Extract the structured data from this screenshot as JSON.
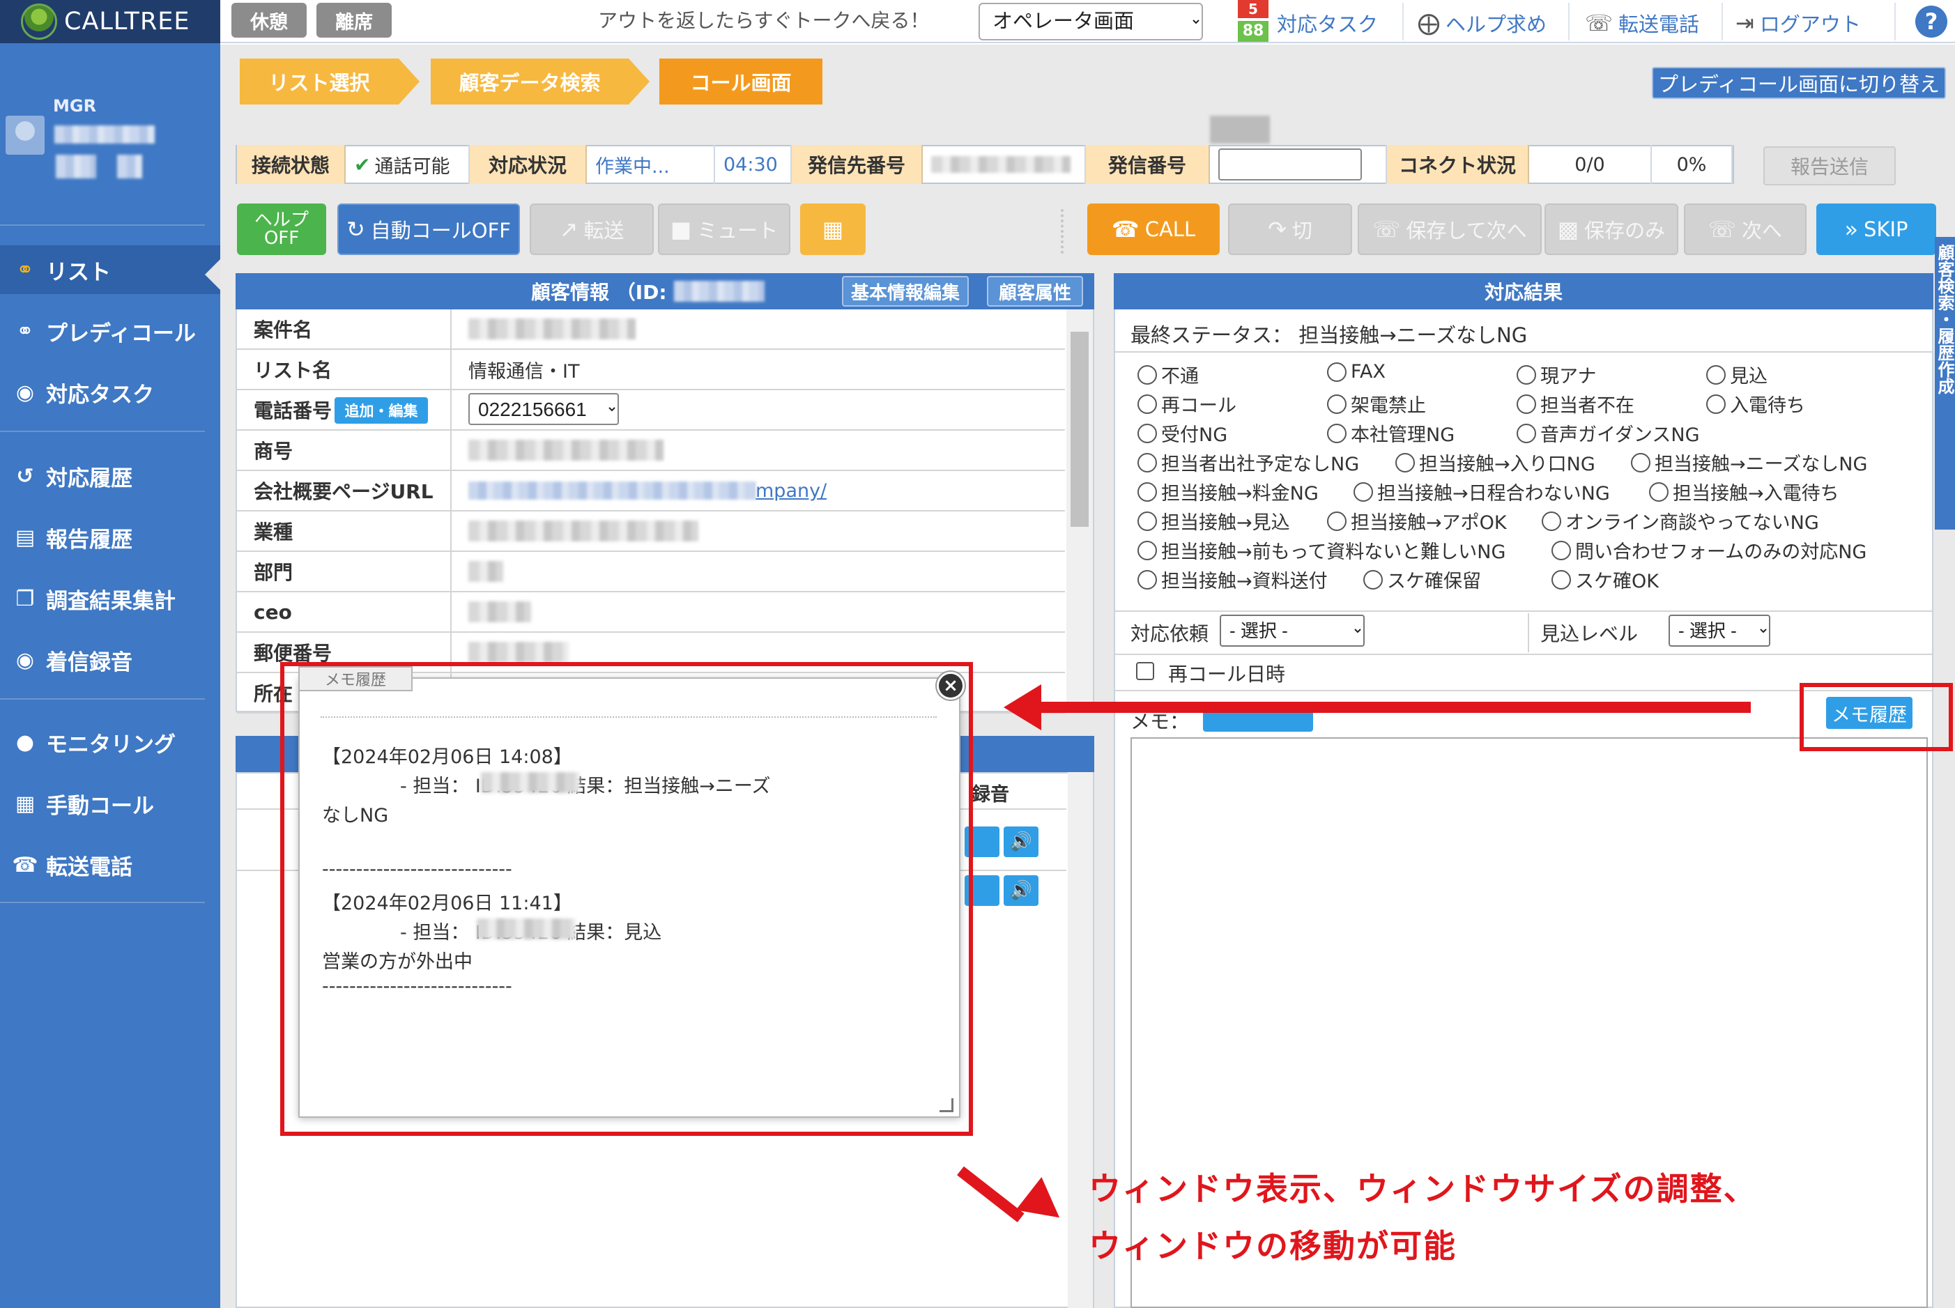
{
  "app": {
    "logo": "CALLTREE"
  },
  "sidebar": {
    "role": "MGR",
    "items": [
      {
        "label": "リスト",
        "icon": "headset-icon"
      },
      {
        "label": "プレディコール",
        "icon": "headset-icon"
      },
      {
        "label": "対応タスク",
        "icon": "task-icon"
      },
      {
        "label": "対応履歴",
        "icon": "history-icon"
      },
      {
        "label": "報告履歴",
        "icon": "calendar-icon"
      },
      {
        "label": "調査結果集計",
        "icon": "copy-icon"
      },
      {
        "label": "着信録音",
        "icon": "record-icon"
      },
      {
        "label": "モニタリング",
        "icon": "monitor-icon"
      },
      {
        "label": "手動コール",
        "icon": "keypad-icon"
      },
      {
        "label": "転送電話",
        "icon": "transfer-icon"
      }
    ]
  },
  "topbar": {
    "break_label": "休憩",
    "away_label": "離席",
    "message": "アウトを返したらすぐトークへ戻る！",
    "view_selected": "オペレータ画面",
    "badge_top": "5",
    "badge_bottom": "88",
    "task_label": "対応タスク",
    "help_label": "ヘルプ求め",
    "transfer_label": "転送電話",
    "logout_label": "ログアウト",
    "question": "?"
  },
  "steps": [
    "リスト選択",
    "顧客データ検索",
    "コール画面"
  ],
  "switch_label": "プレディコール画面に切り替え",
  "status_strip": {
    "conn_label": "接続状態",
    "conn_value": "通話可能",
    "resp_label": "対応状況",
    "resp_value": "作業中...",
    "timer": "04:30",
    "dest_label": "発信先番号",
    "caller_label": "発信番号",
    "connect_label": "コネクト状況",
    "connect_count": "0/0",
    "connect_pct": "0%",
    "report_label": "報告送信"
  },
  "actions": {
    "help_line1": "ヘルプ",
    "help_line2": "OFF",
    "auto_call": "自動コールOFF",
    "transfer": "転送",
    "mute": "ミュート",
    "call": "CALL",
    "hangup": "切",
    "save_next": "保存して次へ",
    "save_only": "保存のみ",
    "next": "次へ",
    "skip": "SKIP"
  },
  "customer": {
    "header": "顧客情報 （ID:",
    "edit_basic": "基本情報編集",
    "attributes": "顧客属性",
    "rows": [
      {
        "label": "案件名",
        "value": ""
      },
      {
        "label": "リスト名",
        "value": "情報通信・IT"
      },
      {
        "label": "電話番号",
        "value": ""
      },
      {
        "label": "商号",
        "value": ""
      },
      {
        "label": "会社概要ページURL",
        "value": "mpany/"
      },
      {
        "label": "業種",
        "value": ""
      },
      {
        "label": "部門",
        "value": ""
      },
      {
        "label": "ceo",
        "value": ""
      },
      {
        "label": "郵便番号",
        "value": ""
      },
      {
        "label": "所在",
        "value": ""
      }
    ],
    "add_edit": "追加・編集",
    "phone": "0222156661"
  },
  "history": {
    "rec_label": "録音"
  },
  "result": {
    "header": "対応結果",
    "final_status": "最終ステータス：  担当接触→ニーズなしNG",
    "options": [
      "不通",
      "FAX",
      "現アナ",
      "見込",
      "再コール",
      "架電禁止",
      "担当者不在",
      "入電待ち",
      "受付NG",
      "本社管理NG",
      "音声ガイダンスNG",
      "担当者出社予定なしNG",
      "担当接触→入り口NG",
      "担当接触→ニーズなしNG",
      "担当接触→料金NG",
      "担当接触→日程合わないNG",
      "担当接触→入電待ち",
      "担当接触→見込",
      "担当接触→アポOK",
      "オンライン商談やってないNG",
      "担当接触→前もって資料ないと難しいNG",
      "問い合わせフォームのみの対応NG",
      "担当接触→資料送付",
      "スケ確保留",
      "スケ確OK"
    ],
    "request_label": "対応依頼",
    "request_value": "- 選択 -",
    "level_label": "見込レベル",
    "level_value": "- 選択 -",
    "recall_label": "再コール日時",
    "memo_label": "メモ：",
    "memo_hist_btn": "メモ履歴",
    "side_tab": "顧客検索・履歴作成"
  },
  "popup": {
    "tab": "メモ履歴",
    "close": "×",
    "entry1_date": "【2024年02月06日 14:08】",
    "entry1_line": "- 担当：             ID:35426  結果：担当接触→ニーズ",
    "entry1_wrap": "なしNG",
    "divider1": "----------------------------",
    "entry2_date": "【2024年02月06日 11:41】",
    "entry2_line": "- 担当：             ID:35426  結果：見込",
    "entry2_note": "営業の方が外出中",
    "divider2": "----------------------------"
  },
  "annotation": {
    "line1": "ウィンドウ表示、ウィンドウサイズの調整、",
    "line2": "ウィンドウの移動が可能",
    "color": "#e0161c"
  }
}
